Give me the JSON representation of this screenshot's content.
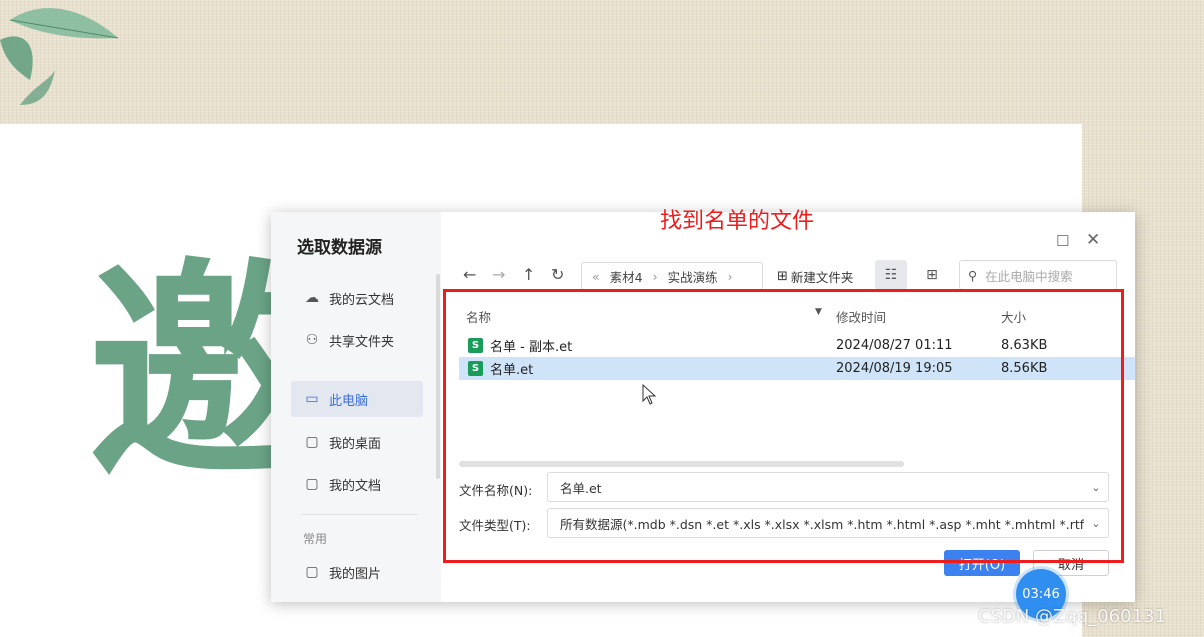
{
  "background": {
    "slide_char": "邀"
  },
  "dialog": {
    "title": "选取数据源",
    "sidebar": {
      "items": [
        {
          "label": "我的云文档",
          "icon": "cloud-icon"
        },
        {
          "label": "共享文件夹",
          "icon": "share-folder-icon"
        },
        {
          "label": "此电脑",
          "icon": "computer-icon",
          "active": true
        },
        {
          "label": "我的桌面",
          "icon": "folder-icon"
        },
        {
          "label": "我的文档",
          "icon": "folder-icon"
        }
      ],
      "group_label": "常用",
      "group_items": [
        {
          "label": "我的图片",
          "icon": "folder-icon"
        }
      ]
    },
    "breadcrumb": {
      "prefix": "«",
      "items": [
        "素材4",
        "实战演练"
      ],
      "separator": "›"
    },
    "new_folder_label": "新建文件夹",
    "search_placeholder": "在此电脑中搜索",
    "columns": {
      "name": "名称",
      "modified": "修改时间",
      "size": "大小"
    },
    "files": [
      {
        "name": "名单 - 副本.et",
        "modified": "2024/08/27 01:11",
        "size": "8.63KB",
        "icon_letter": "S",
        "selected": false
      },
      {
        "name": "名单.et",
        "modified": "2024/08/19 19:05",
        "size": "8.56KB",
        "icon_letter": "S",
        "selected": true
      }
    ],
    "filename_label": "文件名称(N):",
    "filename_value": "名单.et",
    "filetype_label": "文件类型(T):",
    "filetype_value": "所有数据源(*.mdb *.dsn *.et *.xls *.xlsx *.xlsm *.htm *.html *.asp *.mht *.mhtml *.rtf *.do",
    "open_label": "打开(O)",
    "cancel_label": "取消"
  },
  "annotation_text": "找到名单的文件",
  "timer": "03:46",
  "watermark": "CSDN @Zqq_060131",
  "colors": {
    "accent": "#3b82f0",
    "annotation": "#ee1d1d",
    "slide_char": "#6aa386",
    "file_icon": "#1a9c5b"
  }
}
